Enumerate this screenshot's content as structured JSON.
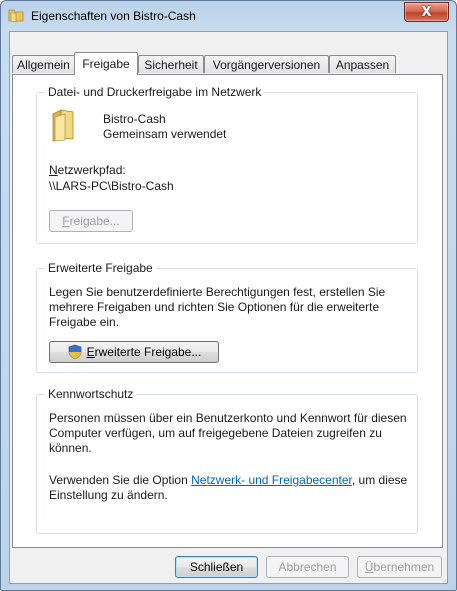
{
  "window": {
    "title": "Eigenschaften von Bistro-Cash",
    "close_glyph": "X"
  },
  "tabs": [
    {
      "label": "Allgemein"
    },
    {
      "label": "Freigabe"
    },
    {
      "label": "Sicherheit"
    },
    {
      "label": "Vorgängerversionen"
    },
    {
      "label": "Anpassen"
    }
  ],
  "active_tab": "Freigabe",
  "network_sharing": {
    "legend": "Datei- und Druckerfreigabe im Netzwerk",
    "folder_name": "Bistro-Cash",
    "folder_status": "Gemeinsam verwendet",
    "path_label_accel": "N",
    "path_label_rest": "etzwerkpfad:",
    "path_value": "\\\\LARS-PC\\Bistro-Cash",
    "share_button_accel": "F",
    "share_button_rest": "reigabe..."
  },
  "advanced_sharing": {
    "legend": "Erweiterte Freigabe",
    "description": "Legen Sie benutzerdefinierte Berechtigungen fest, erstellen Sie mehrere Freigaben und richten Sie Optionen für die erweiterte Freigabe ein.",
    "button_accel": "E",
    "button_rest": "rweiterte Freigabe..."
  },
  "password_protection": {
    "legend": "Kennwortschutz",
    "description": "Personen müssen über ein Benutzerkonto und Kennwort für diesen Computer verfügen, um auf freigegebene Dateien zugreifen zu können.",
    "option_prefix": "Verwenden Sie die Option ",
    "option_link": "Netzwerk- und Freigabecenter",
    "option_suffix": ", um diese Einstellung zu ändern."
  },
  "footer": {
    "close": "Schließen",
    "cancel": "Abbrechen",
    "apply_accel": "Ü",
    "apply_rest": "bernehmen"
  },
  "colors": {
    "link": "#0066cc",
    "close_button": "#c2432b",
    "window_frame": "#b9d1ea"
  }
}
